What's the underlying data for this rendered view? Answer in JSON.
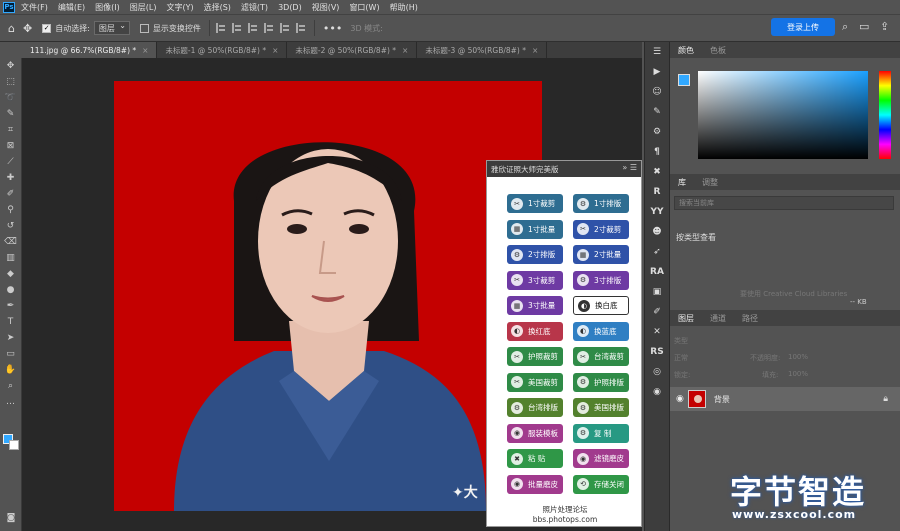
{
  "menu": [
    "文件(F)",
    "编辑(E)",
    "图像(I)",
    "图层(L)",
    "文字(Y)",
    "选择(S)",
    "滤镜(T)",
    "3D(D)",
    "视图(V)",
    "窗口(W)",
    "帮助(H)"
  ],
  "options": {
    "auto_select_label": "自动选择:",
    "auto_select_value": "图层",
    "show_transform_label": "显示变换控件",
    "mode3d": "3D 模式:",
    "cloud_button": "登录上传"
  },
  "tabs": [
    {
      "label": "111.jpg @ 66.7%(RGB/8#) *",
      "active": true
    },
    {
      "label": "未标题-1 @ 50%(RGB/8#) *",
      "active": false
    },
    {
      "label": "未标题-2 @ 50%(RGB/8#) *",
      "active": false
    },
    {
      "label": "未标题-3 @ 50%(RGB/8#) *",
      "active": false
    }
  ],
  "canvas_watermark": "✦大",
  "plugin": {
    "title": "雅欣证照大师完美版",
    "buttons": [
      {
        "label": "1寸裁剪",
        "color": "#2e6d91",
        "icon": "✂"
      },
      {
        "label": "1寸排版",
        "color": "#2e6d91",
        "icon": "⚙"
      },
      {
        "label": "1寸批量",
        "color": "#2e6d91",
        "icon": "▦"
      },
      {
        "label": "2寸裁剪",
        "color": "#2f52a8",
        "icon": "✂"
      },
      {
        "label": "2寸排版",
        "color": "#2f52a8",
        "icon": "⚙"
      },
      {
        "label": "2寸批量",
        "color": "#2f52a8",
        "icon": "▦"
      },
      {
        "label": "3寸裁剪",
        "color": "#6e3aa3",
        "icon": "✂"
      },
      {
        "label": "3寸排版",
        "color": "#6e3aa3",
        "icon": "⚙"
      },
      {
        "label": "3寸批量",
        "color": "#6e3aa3",
        "icon": "▦"
      },
      {
        "label": "换白底",
        "color": "#ffffff",
        "icon": "◐"
      },
      {
        "label": "换红底",
        "color": "#b8364a",
        "icon": "◐"
      },
      {
        "label": "换蓝底",
        "color": "#2f7fc3",
        "icon": "◐"
      },
      {
        "label": "护照裁剪",
        "color": "#2f8b47",
        "icon": "✂"
      },
      {
        "label": "台湾裁剪",
        "color": "#2f8b47",
        "icon": "✂"
      },
      {
        "label": "美国裁剪",
        "color": "#2f8b47",
        "icon": "✂"
      },
      {
        "label": "护照排版",
        "color": "#2f8b47",
        "icon": "⚙"
      },
      {
        "label": "台湾排版",
        "color": "#53812d",
        "icon": "⚙"
      },
      {
        "label": "美国排版",
        "color": "#53812d",
        "icon": "⚙"
      },
      {
        "label": "服装模板",
        "color": "#a13a8d",
        "icon": "◉"
      },
      {
        "label": "复 制",
        "color": "#279983",
        "icon": "⚙"
      },
      {
        "label": "粘 贴",
        "color": "#2f9747",
        "icon": "✖"
      },
      {
        "label": "滤镜磨皮",
        "color": "#a13a8d",
        "icon": "◉"
      },
      {
        "label": "批量磨皮",
        "color": "#a13a8d",
        "icon": "◉"
      },
      {
        "label": "存储关闭",
        "color": "#2f9747",
        "icon": "⟲"
      }
    ],
    "footer_name": "照片处理论坛",
    "footer_url": "bbs.photops.com"
  },
  "panels": {
    "color_tabs": [
      "颜色",
      "色板"
    ],
    "library_tabs": [
      "库",
      "调整"
    ],
    "library_search": "搜索当前库",
    "library_view": "按类型查看",
    "library_message": "要使用 Creative Cloud Libraries",
    "library_kb": "-- KB",
    "layers_tabs": [
      "图层",
      "通道",
      "路径"
    ],
    "layer_filter": "类型",
    "blend_mode": "正常",
    "opacity_label": "不透明度:",
    "opacity_value": "100%",
    "lock_label": "锁定:",
    "fill_label": "填充:",
    "fill_value": "100%",
    "layer_name": "背景"
  },
  "watermark_brand": "字节智造",
  "watermark_url": "www.zsxcool.com",
  "colors": {
    "fg": "#31a8ff",
    "bg": "#ffffff",
    "backdrop": "#c40000",
    "cloud": "#1473e6"
  }
}
